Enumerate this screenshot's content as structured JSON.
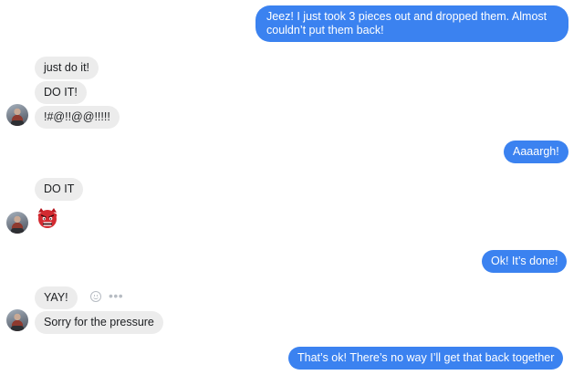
{
  "messages": {
    "out_1": "Jeez! I just took 3 pieces out and dropped them. Almost couldn’t put them back!",
    "in_1": "just do it!",
    "in_2": "DO IT!",
    "in_3": "!#@!!@@!!!!!",
    "out_2": "Aaaargh!",
    "in_4": "DO IT",
    "in_5_emoji": "angry-devil-emoji",
    "out_3": "Ok! It’s done!",
    "in_6": "YAY!",
    "in_7": "Sorry for the pressure",
    "out_4": "That’s ok! There’s no way I’ll get that back together"
  },
  "icons": {
    "reaction": "smiley-reaction-icon",
    "more": "more-options-icon"
  },
  "colors": {
    "outgoing_bubble": "#3b82f0",
    "incoming_bubble": "#ececec"
  }
}
